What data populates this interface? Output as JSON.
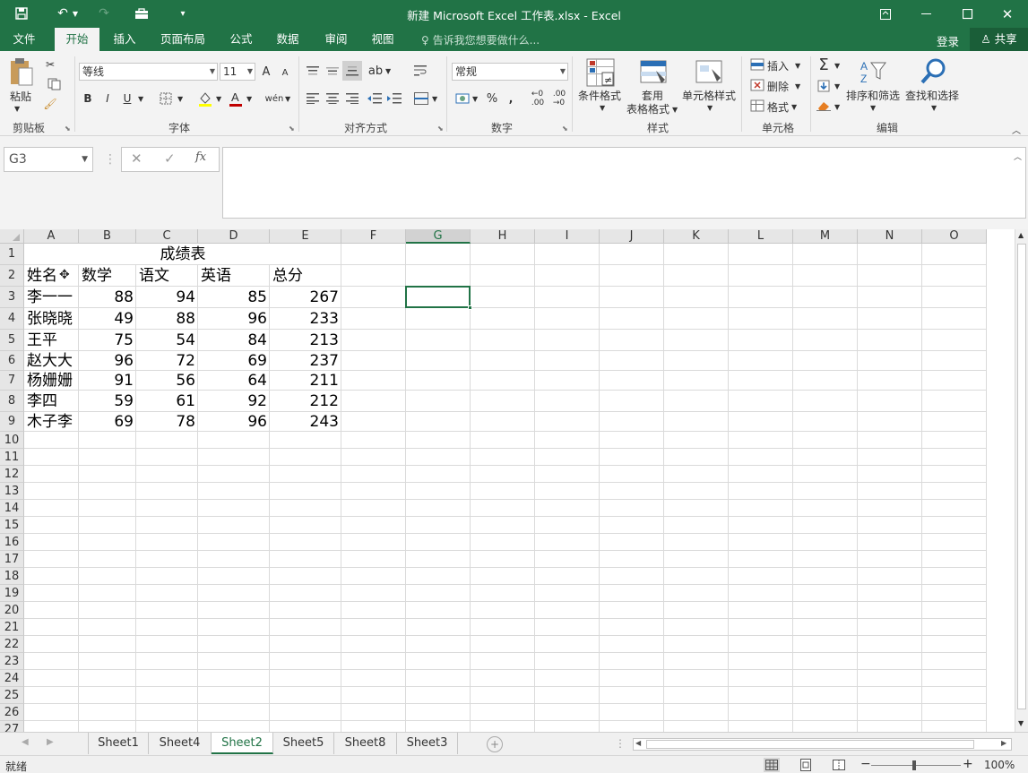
{
  "window": {
    "title": "新建 Microsoft Excel 工作表.xlsx - Excel"
  },
  "ribbon_tabs": [
    "文件",
    "开始",
    "插入",
    "页面布局",
    "公式",
    "数据",
    "审阅",
    "视图"
  ],
  "active_tab": "开始",
  "tell_me": "告诉我您想要做什么...",
  "signin": "登录",
  "share": "共享",
  "clipboard": {
    "paste": "粘贴",
    "group": "剪贴板"
  },
  "font": {
    "name": "等线",
    "size": "11",
    "bold": "B",
    "italic": "I",
    "underline": "U",
    "grow": "A",
    "shrink": "A",
    "phonetic": "wén",
    "group": "字体"
  },
  "alignment": {
    "group": "对齐方式"
  },
  "number": {
    "format": "常规",
    "percent": "%",
    "comma": ",",
    "group": "数字"
  },
  "styles": {
    "conditional": "条件格式",
    "table_line1": "套用",
    "table_line2": "表格格式",
    "cell_styles": "单元格样式",
    "group": "样式"
  },
  "cells": {
    "insert": "插入",
    "delete": "删除",
    "format": "格式",
    "group": "单元格"
  },
  "editing": {
    "sum": "Σ",
    "sort": "排序和筛选",
    "find": "查找和选择",
    "group": "编辑"
  },
  "name_box": "G3",
  "fx": "fx",
  "columns": [
    "A",
    "B",
    "C",
    "D",
    "E",
    "F",
    "G",
    "H",
    "I",
    "J",
    "K",
    "L",
    "M",
    "N",
    "O"
  ],
  "selected_column": "G",
  "row_numbers": [
    "1",
    "2",
    "3",
    "4",
    "5",
    "6",
    "7",
    "8",
    "9",
    "10",
    "11",
    "12",
    "13",
    "14",
    "15",
    "16",
    "17",
    "18",
    "19",
    "20",
    "21",
    "22",
    "23",
    "24",
    "25",
    "26",
    "27"
  ],
  "sheet": {
    "title": "成绩表",
    "headers": [
      "姓名",
      "数学",
      "语文",
      "英语",
      "总分"
    ],
    "rows": [
      [
        "李一一",
        "88",
        "94",
        "85",
        "267"
      ],
      [
        "张晓晓",
        "49",
        "88",
        "96",
        "233"
      ],
      [
        "王平",
        "75",
        "54",
        "84",
        "213"
      ],
      [
        "赵大大",
        "96",
        "72",
        "69",
        "237"
      ],
      [
        "杨姗姗",
        "91",
        "56",
        "64",
        "211"
      ],
      [
        "李四",
        "59",
        "61",
        "92",
        "212"
      ],
      [
        "木子李",
        "69",
        "78",
        "96",
        "243"
      ]
    ]
  },
  "sheet_tabs": [
    "Sheet1",
    "Sheet4",
    "Sheet2",
    "Sheet5",
    "Sheet8",
    "Sheet3"
  ],
  "active_sheet": "Sheet2",
  "status": {
    "ready": "就绪",
    "zoom": "100%"
  },
  "colors": {
    "accent": "#217346",
    "share_bg": "#1a5e38"
  }
}
